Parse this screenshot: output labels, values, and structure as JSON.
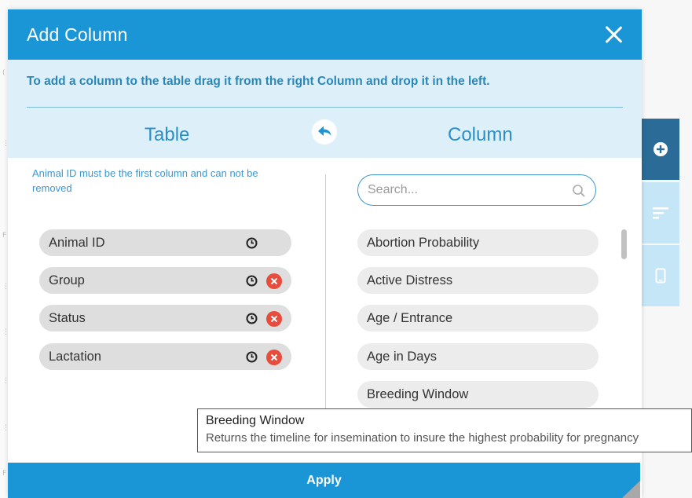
{
  "modal": {
    "title": "Add Column",
    "instruction": "To add a column to the table drag it from the right Column and drop it in the left.",
    "table_heading": "Table",
    "column_heading": "Column",
    "note": "Animal ID must be the first column and can not be removed",
    "apply_label": "Apply"
  },
  "table_columns": [
    {
      "label": "Animal ID",
      "removable": false
    },
    {
      "label": "Group",
      "removable": true
    },
    {
      "label": "Status",
      "removable": true
    },
    {
      "label": "Lactation",
      "removable": true
    }
  ],
  "search": {
    "placeholder": "Search...",
    "value": ""
  },
  "available_columns": [
    {
      "label": "Abortion Probability"
    },
    {
      "label": "Active Distress"
    },
    {
      "label": "Age / Entrance"
    },
    {
      "label": "Age in Days"
    },
    {
      "label": "Breeding Window"
    }
  ],
  "tooltip": {
    "title": "Breeding Window",
    "description": "Returns the timeline for  insemination to insure the highest probability for pregnancy"
  },
  "colors": {
    "header": "#1a96d6",
    "band": "#ddf0fa",
    "accent_text": "#2a8fc6",
    "remove": "#e84c3d",
    "active_tab": "#2a6c97",
    "inactive_tab": "#c5e6f6"
  }
}
